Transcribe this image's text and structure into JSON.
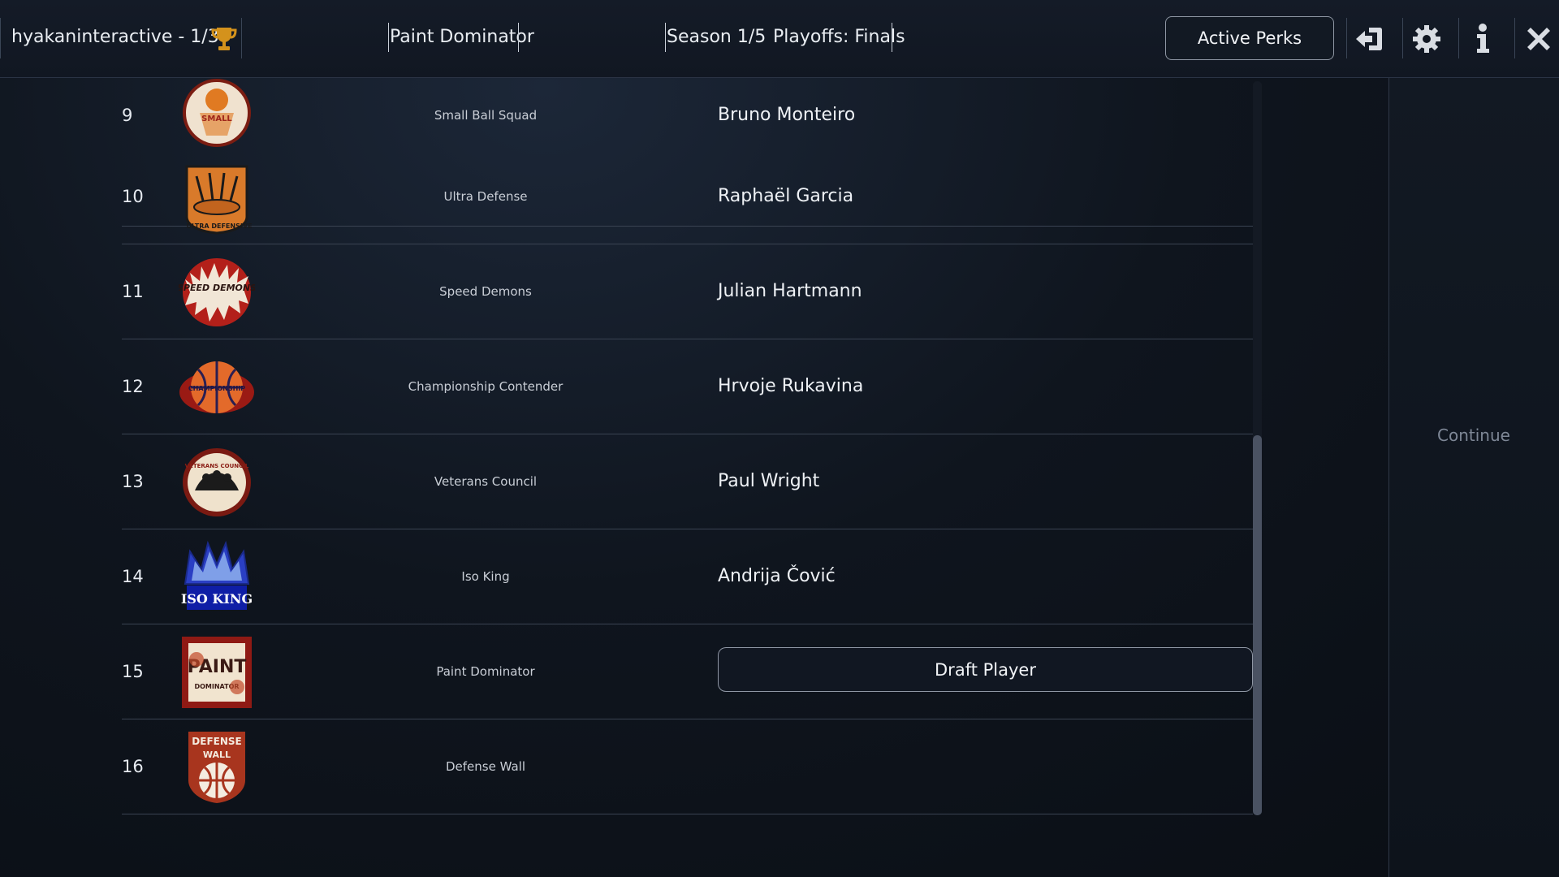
{
  "header": {
    "profile": "hyakaninteractive - 1/3",
    "team_name": "Paint Dominator",
    "season": "Season 1/5",
    "phase": "Playoffs: Finals",
    "perks_label": "Active Perks",
    "icons": [
      "trophy-icon",
      "exit-icon",
      "gear-icon",
      "info-icon",
      "close-icon"
    ]
  },
  "draft": {
    "rows": [
      {
        "rank": "9",
        "team": "Small Ball Squad",
        "player": "Bruno Monteiro",
        "logo_text": "SMALL"
      },
      {
        "rank": "10",
        "team": "Ultra Defense",
        "player": "Raphaël Garcia",
        "logo_text": "ULTRA DEFENSIVE"
      },
      {
        "rank": "11",
        "team": "Speed Demons",
        "player": "Julian Hartmann",
        "logo_text": "SPEED DEMONS"
      },
      {
        "rank": "12",
        "team": "Championship Contender",
        "player": "Hrvoje Rukavina",
        "logo_text": "CHAMPIONSHIP"
      },
      {
        "rank": "13",
        "team": "Veterans Council",
        "player": "Paul Wright",
        "logo_text": "VETERANS COUNCIL"
      },
      {
        "rank": "14",
        "team": "Iso King",
        "player": "Andrija Čović",
        "logo_text": "ISO KING"
      },
      {
        "rank": "15",
        "team": "Paint Dominator",
        "player": "",
        "logo_text": "PAINT DOMINATOR"
      },
      {
        "rank": "16",
        "team": "Defense Wall",
        "player": "",
        "logo_text": "DEFENSE WALL"
      }
    ],
    "draft_button_label": "Draft Player"
  },
  "side_panel": {
    "continue_label": "Continue"
  },
  "colors": {
    "background": "#0b1018",
    "header": "#141b27",
    "accent_gold": "#d4921c",
    "button_border": "#8f97a4",
    "muted_text": "#7e8796"
  }
}
